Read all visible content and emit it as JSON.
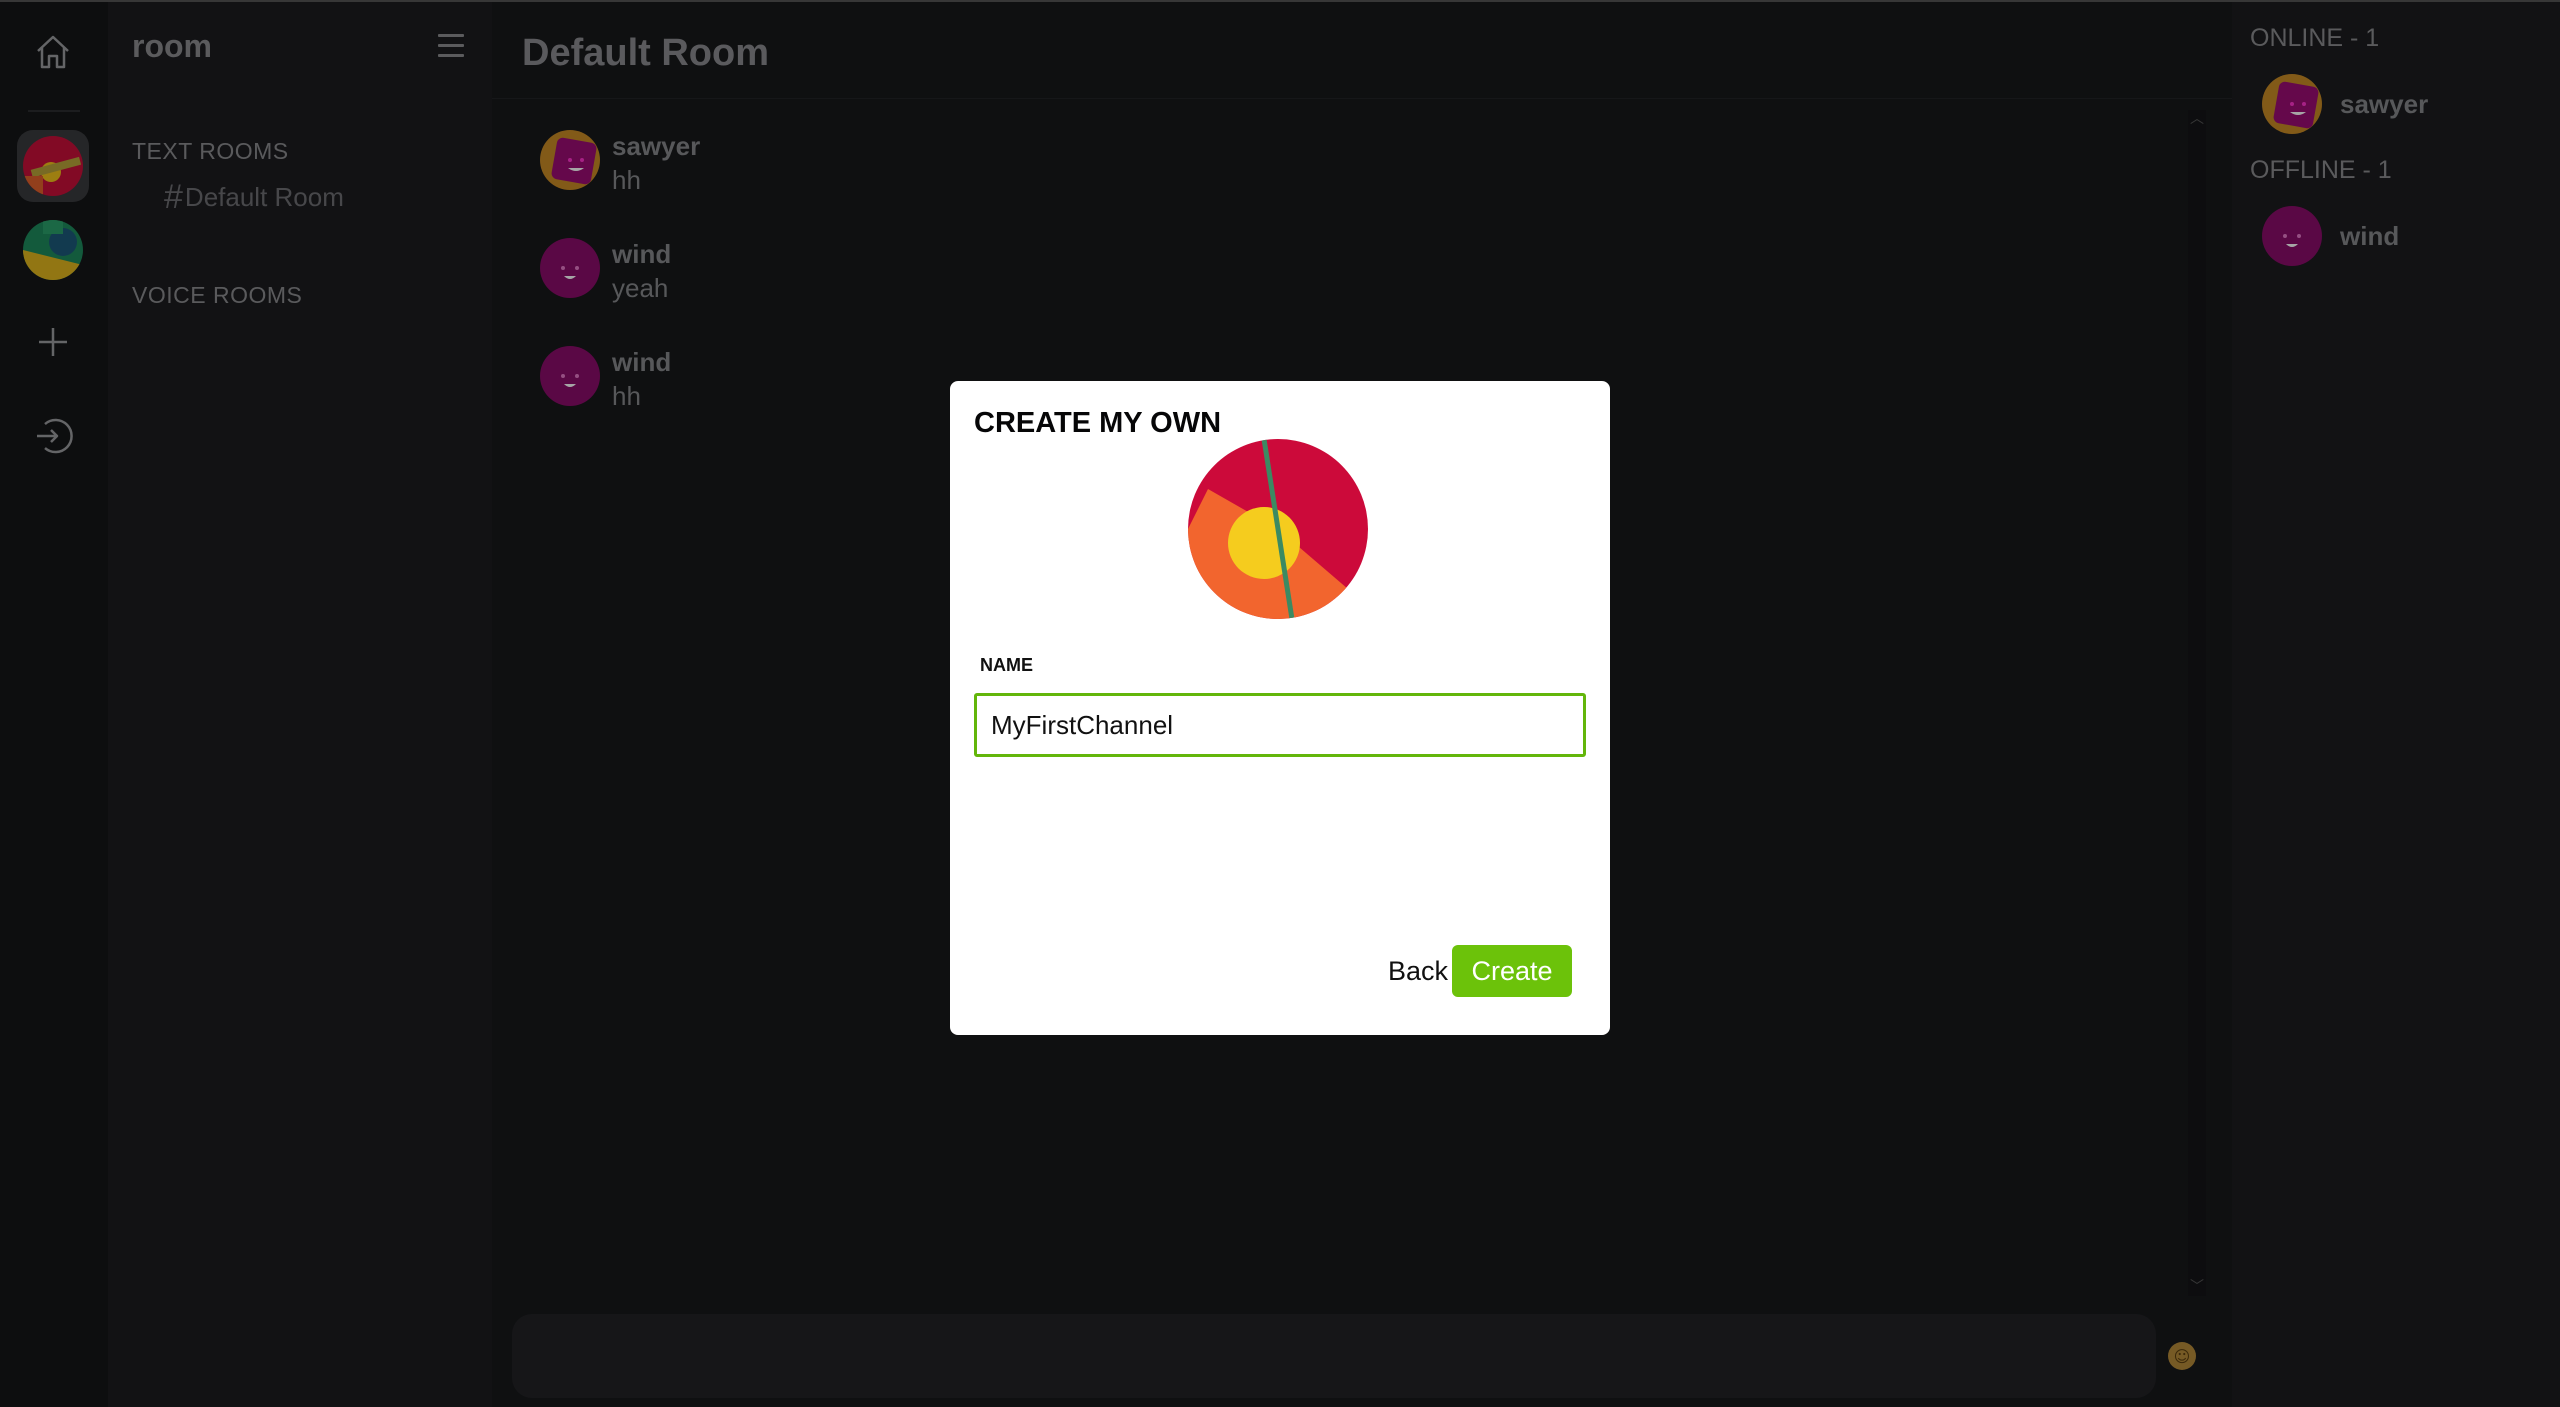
{
  "rail": {
    "icons": [
      "home-icon",
      "server-avatar-red",
      "server-avatar-green",
      "plus-icon",
      "sign-in-icon"
    ]
  },
  "sidebar": {
    "server_name": "room",
    "text_rooms_label": "TEXT ROOMS",
    "voice_rooms_label": "VOICE ROOMS",
    "channels": [
      {
        "name": "Default Room"
      }
    ]
  },
  "main": {
    "room_title": "Default Room",
    "messages": [
      {
        "author": "sawyer",
        "text": "hh"
      },
      {
        "author": "wind",
        "text": "yeah"
      },
      {
        "author": "wind",
        "text": "hh"
      }
    ],
    "composer_placeholder": ""
  },
  "members": {
    "online_label": "ONLINE - 1",
    "offline_label": "OFFLINE - 1",
    "online": [
      {
        "name": "sawyer"
      }
    ],
    "offline": [
      {
        "name": "wind"
      }
    ]
  },
  "modal": {
    "title": "CREATE MY OWN",
    "name_label": "NAME",
    "name_value": "MyFirstChannel",
    "back_label": "Back",
    "create_label": "Create"
  },
  "colors": {
    "accent_green": "#6cc20a",
    "input_border": "#63b60a",
    "avatar_sawyer_bg": "#c88a26",
    "avatar_wind_bg": "#8a0d6a"
  }
}
